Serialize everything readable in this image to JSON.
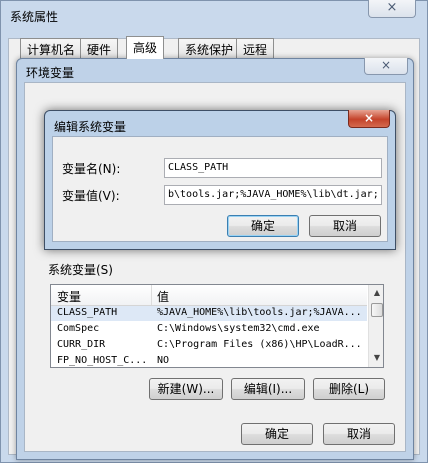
{
  "system_properties": {
    "title": "系统属性",
    "tabs": [
      "计算机名",
      "硬件",
      "高级",
      "系统保护",
      "远程"
    ],
    "active_tab": 2,
    "close_icon": "×"
  },
  "env_window": {
    "title": "环境变量",
    "close_icon": "×",
    "system_vars_label": "系统变量(S)",
    "columns": [
      "变量",
      "值"
    ],
    "rows": [
      {
        "name": "CLASS_PATH",
        "value": "%JAVA_HOME%\\lib\\tools.jar;%JAVA..."
      },
      {
        "name": "ComSpec",
        "value": "C:\\Windows\\system32\\cmd.exe"
      },
      {
        "name": "CURR_DIR",
        "value": "C:\\Program Files (x86)\\HP\\LoadR..."
      },
      {
        "name": "FP_NO_HOST_C...",
        "value": "NO"
      }
    ],
    "selected_row": 0,
    "new_button": "新建(W)...",
    "edit_button": "编辑(I)...",
    "delete_button": "删除(L)",
    "ok_button": "确定",
    "cancel_button": "取消",
    "scroll_up": "▲",
    "scroll_down": "▼"
  },
  "edit_dialog": {
    "title": "编辑系统变量",
    "close_icon": "×",
    "name_label": "变量名(N):",
    "value_label": "变量值(V):",
    "name_value": "CLASS_PATH",
    "value_value": "b\\tools.jar;%JAVA_HOME%\\lib\\dt.jar;",
    "ok_button": "确定",
    "cancel_button": "取消"
  }
}
